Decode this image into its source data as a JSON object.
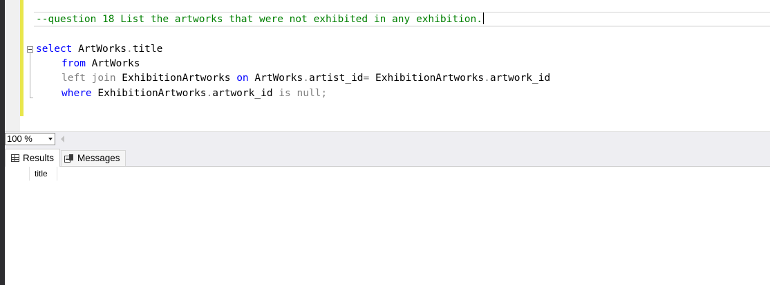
{
  "editor": {
    "comment_line": "--question 18 List the artworks that were not exhibited in any exhibition.",
    "line1": {
      "kw": "select",
      "rest": " ArtWorks",
      "dot": ".",
      "after": "title"
    },
    "line2": {
      "kw": "from",
      "rest": " ArtWorks"
    },
    "line3": {
      "left": "left",
      "join": " join",
      "t1": " ExhibitionArtworks ",
      "on": "on",
      "t2": " ArtWorks",
      "dot1": ".",
      "t3": "artist_id",
      "eq": "=",
      "t4": " ExhibitionArtworks",
      "dot2": ".",
      "t5": "artwork_id"
    },
    "line4": {
      "kw": "where",
      "t1": " ExhibitionArtworks",
      "dot": ".",
      "t2": "artwork_id ",
      "is": "is",
      "null": " null",
      "semi": ";"
    }
  },
  "zoom": {
    "value": "100 %"
  },
  "tabs": {
    "results_label": "Results",
    "messages_label": "Messages"
  },
  "results": {
    "columns": [
      "title"
    ]
  },
  "icons": {
    "results_tab": "grid-icon",
    "messages_tab": "messages-icon",
    "zoom_dropdown": "chevron-down-icon",
    "scroll_left": "scroll-left-arrow-icon",
    "collapse": "collapse-minus-icon"
  },
  "colors": {
    "keyword": "#0000ff",
    "comment": "#008000",
    "operator_gray": "#808080",
    "change_bar": "#e8e64b"
  }
}
